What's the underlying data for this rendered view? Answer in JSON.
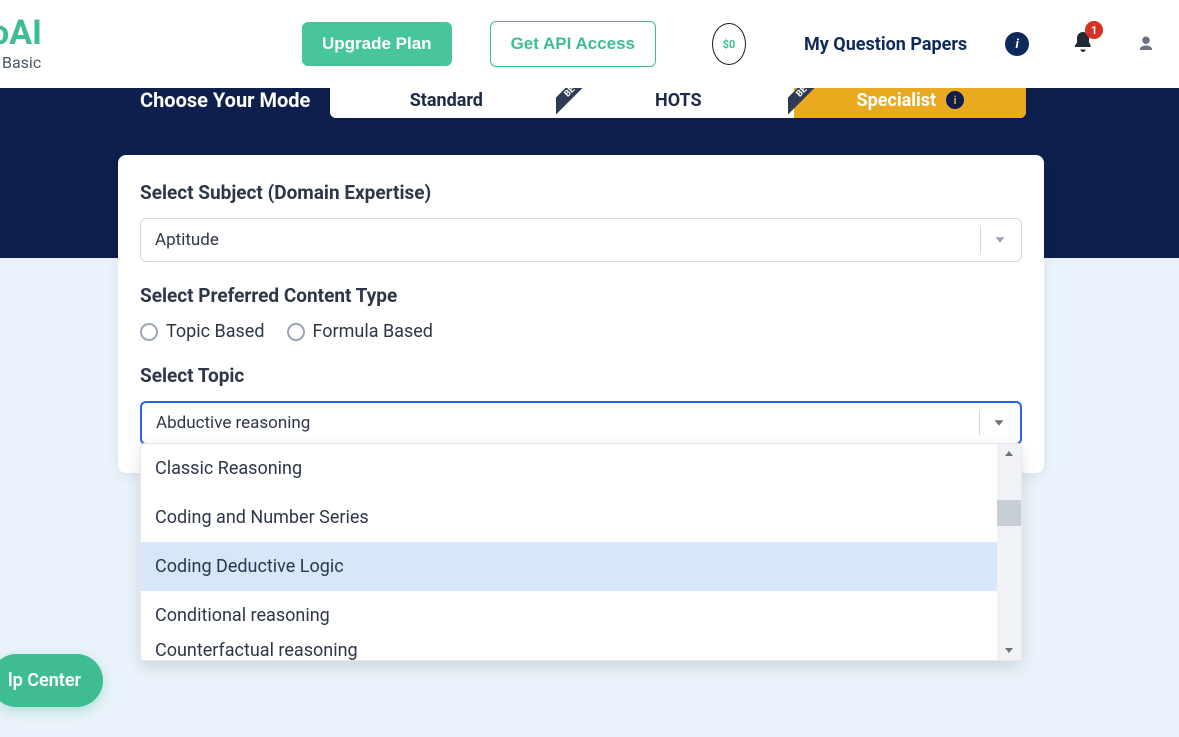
{
  "header": {
    "logo_text": "oAI",
    "logo_sub": "Basic",
    "upgrade_label": "Upgrade Plan",
    "api_label": "Get API Access",
    "credits": "$0",
    "my_papers": "My Question Papers",
    "notifications_count": "1"
  },
  "mode": {
    "title": "Choose Your Mode",
    "tabs": [
      {
        "label": "Standard"
      },
      {
        "label": "HOTS"
      },
      {
        "label": "Specialist"
      }
    ]
  },
  "form": {
    "subject_label": "Select Subject (Domain Expertise)",
    "subject_value": "Aptitude",
    "content_type_label": "Select Preferred Content Type",
    "radios": [
      {
        "label": "Topic Based"
      },
      {
        "label": "Formula Based"
      }
    ],
    "topic_label": "Select Topic",
    "topic_value": "Abductive reasoning",
    "topic_options": [
      {
        "label": "Classic Reasoning",
        "highlighted": false
      },
      {
        "label": "Coding and Number Series",
        "highlighted": false
      },
      {
        "label": "Coding Deductive Logic",
        "highlighted": true
      },
      {
        "label": "Conditional reasoning",
        "highlighted": false
      },
      {
        "label": "Counterfactual reasoning",
        "highlighted": false
      }
    ]
  },
  "help_label": "lp Center"
}
